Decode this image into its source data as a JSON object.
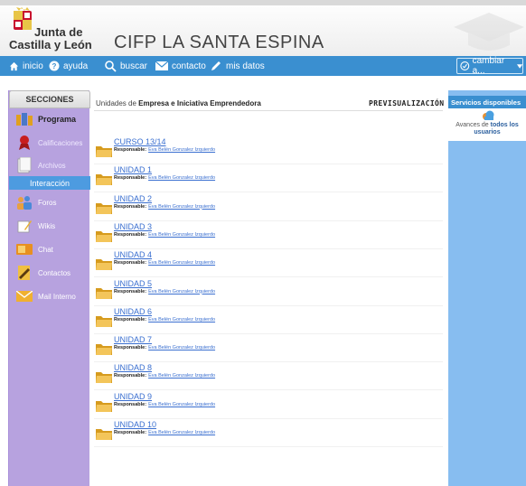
{
  "header": {
    "logo_line1": "Junta de",
    "logo_line2": "Castilla y León",
    "site_title": "CIFP LA SANTA ESPINA"
  },
  "nav": {
    "items": [
      {
        "label": "inicio",
        "icon": "home-icon"
      },
      {
        "label": "ayuda",
        "icon": "help-icon"
      },
      {
        "label": "buscar",
        "icon": "search-icon"
      },
      {
        "label": "contacto",
        "icon": "mail-icon"
      },
      {
        "label": "mis datos",
        "icon": "pencil-icon"
      }
    ],
    "change_label": "cambiar a..."
  },
  "sidebar": {
    "title": "SECCIONES",
    "items": [
      {
        "label": "Programa",
        "icon": "programa-icon",
        "active": true
      },
      {
        "label": "Calificaciones",
        "icon": "medal-icon"
      },
      {
        "label": "Archivos",
        "icon": "files-icon"
      }
    ],
    "section_label": "Interacción",
    "items2": [
      {
        "label": "Foros",
        "icon": "forum-icon"
      },
      {
        "label": "Wikis",
        "icon": "wiki-icon"
      },
      {
        "label": "Chat",
        "icon": "chat-icon"
      },
      {
        "label": "Contactos",
        "icon": "contacts-icon"
      },
      {
        "label": "Mail Interno",
        "icon": "mail-icon"
      }
    ]
  },
  "main": {
    "heading_prefix": "Unidades de",
    "heading_name": "Empresa e Iniciativa Emprendedora",
    "preview_label": "PREVISUALIZACIÓN",
    "responsable_label": "Responsable:",
    "units": [
      {
        "title": "CURSO 13/14",
        "responsible": "Eva Belén Gonzalez Izquierdo"
      },
      {
        "title": "UNIDAD 1",
        "responsible": "Eva Belén Gonzalez Izquierdo"
      },
      {
        "title": "UNIDAD 2",
        "responsible": "Eva Belén Gonzalez Izquierdo"
      },
      {
        "title": "UNIDAD 3",
        "responsible": "Eva Belén Gonzalez Izquierdo"
      },
      {
        "title": "UNIDAD 4",
        "responsible": "Eva Belén Gonzalez Izquierdo"
      },
      {
        "title": "UNIDAD 5",
        "responsible": "Eva Belén Gonzalez Izquierdo"
      },
      {
        "title": "UNIDAD 6",
        "responsible": "Eva Belén Gonzalez Izquierdo"
      },
      {
        "title": "UNIDAD 7",
        "responsible": "Eva Belén Gonzalez Izquierdo"
      },
      {
        "title": "UNIDAD 8",
        "responsible": "Eva Belén Gonzalez Izquierdo"
      },
      {
        "title": "UNIDAD 9",
        "responsible": "Eva Belén Gonzalez Izquierdo"
      },
      {
        "title": "UNIDAD 10",
        "responsible": "Eva Belén Gonzalez Izquierdo"
      }
    ]
  },
  "right_panel": {
    "title": "Servicios disponibles",
    "text_prefix": "Avances de",
    "text_bold": "todos los usuarios"
  },
  "colors": {
    "nav_blue": "#3a8fd0",
    "sidebar_purple": "#b7a2df",
    "right_panel_blue": "#87bdf0",
    "link_blue": "#3a6fd0"
  }
}
